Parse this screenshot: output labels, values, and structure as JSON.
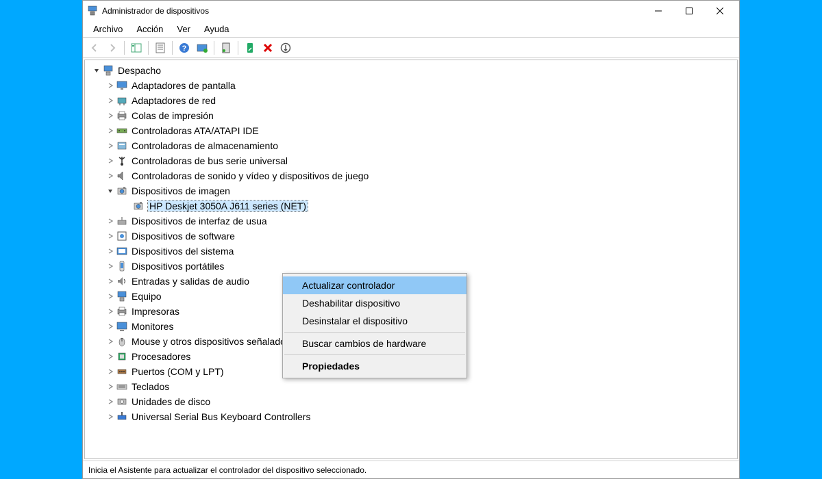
{
  "titlebar": {
    "title": "Administrador de dispositivos"
  },
  "menus": {
    "file": "Archivo",
    "action": "Acción",
    "view": "Ver",
    "help": "Ayuda"
  },
  "statusbar": {
    "text": "Inicia el Asistente para actualizar el controlador del dispositivo seleccionado."
  },
  "tree": {
    "root": "Despacho",
    "items": [
      {
        "label": "Adaptadores de pantalla",
        "icon": "display"
      },
      {
        "label": "Adaptadores de red",
        "icon": "network"
      },
      {
        "label": "Colas de impresión",
        "icon": "printer"
      },
      {
        "label": "Controladoras ATA/ATAPI IDE",
        "icon": "ata"
      },
      {
        "label": "Controladoras de almacenamiento",
        "icon": "storage"
      },
      {
        "label": "Controladoras de bus serie universal",
        "icon": "usb"
      },
      {
        "label": "Controladoras de sonido y vídeo y dispositivos de juego",
        "icon": "sound"
      },
      {
        "label": "Dispositivos de imagen",
        "icon": "imaging",
        "expanded": true,
        "children": [
          {
            "label": "HP Deskjet 3050A J611 series (NET)",
            "icon": "imaging",
            "selected": true
          }
        ]
      },
      {
        "label": "Dispositivos de interfaz de usua",
        "icon": "hid"
      },
      {
        "label": "Dispositivos de software",
        "icon": "software"
      },
      {
        "label": "Dispositivos del sistema",
        "icon": "system"
      },
      {
        "label": "Dispositivos portátiles",
        "icon": "portable"
      },
      {
        "label": "Entradas y salidas de audio",
        "icon": "audioinout"
      },
      {
        "label": "Equipo",
        "icon": "computer"
      },
      {
        "label": "Impresoras",
        "icon": "printer"
      },
      {
        "label": "Monitores",
        "icon": "monitor"
      },
      {
        "label": "Mouse y otros dispositivos señaladores",
        "icon": "mouse"
      },
      {
        "label": "Procesadores",
        "icon": "cpu"
      },
      {
        "label": "Puertos (COM y LPT)",
        "icon": "ports"
      },
      {
        "label": "Teclados",
        "icon": "keyboard"
      },
      {
        "label": "Unidades de disco",
        "icon": "disk"
      },
      {
        "label": "Universal Serial Bus Keyboard Controllers",
        "icon": "usbkb"
      }
    ]
  },
  "context_menu": {
    "items": [
      {
        "label": "Actualizar controlador",
        "highlighted": true
      },
      {
        "label": "Deshabilitar dispositivo"
      },
      {
        "label": "Desinstalar el dispositivo"
      },
      {
        "sep": true
      },
      {
        "label": "Buscar cambios de hardware"
      },
      {
        "sep": true
      },
      {
        "label": "Propiedades",
        "bold": true
      }
    ]
  }
}
